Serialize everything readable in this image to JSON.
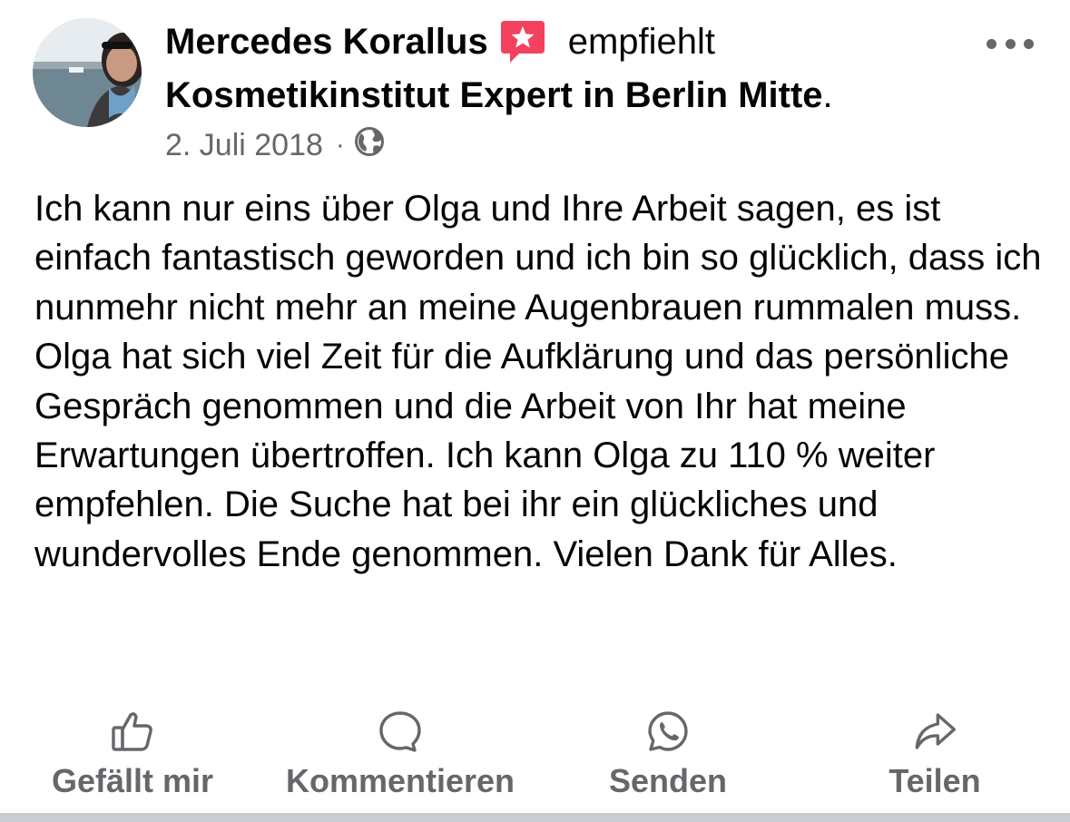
{
  "post": {
    "author": "Mercedes Korallus",
    "recommends_word": "empfiehlt",
    "business": "Kosmetikinstitut Expert in Berlin Mitte",
    "business_period": ".",
    "date": "2. Juli 2018",
    "separator": "·",
    "privacy_icon": "globe-icon",
    "more_icon": "more-horizontal-icon",
    "recommendation_icon": "star-speech-bubble-icon",
    "accent_color": "#f3425f",
    "body": "Ich kann nur eins über Olga und Ihre Arbeit sagen, es ist einfach fantastisch geworden und ich bin so glücklich, dass ich nunmehr nicht mehr an meine Augenbrauen rummalen muss. Olga hat sich viel Zeit für die Aufklärung und das persönliche Gespräch genommen und die Arbeit von Ihr hat meine Erwartungen übertroffen. Ich kann Olga zu 110 % weiter empfehlen. Die Suche hat bei ihr ein glückliches und wundervolles Ende genommen. Vielen Dank für Alles."
  },
  "actions": {
    "like": {
      "label": "Gefällt mir",
      "icon": "thumbs-up-icon"
    },
    "comment": {
      "label": "Kommentieren",
      "icon": "comment-bubble-icon"
    },
    "send": {
      "label": "Senden",
      "icon": "whatsapp-icon"
    },
    "share": {
      "label": "Teilen",
      "icon": "share-arrow-icon"
    }
  },
  "colors": {
    "text_primary": "#050505",
    "text_secondary": "#65676b",
    "divider": "#c9ccd1"
  }
}
